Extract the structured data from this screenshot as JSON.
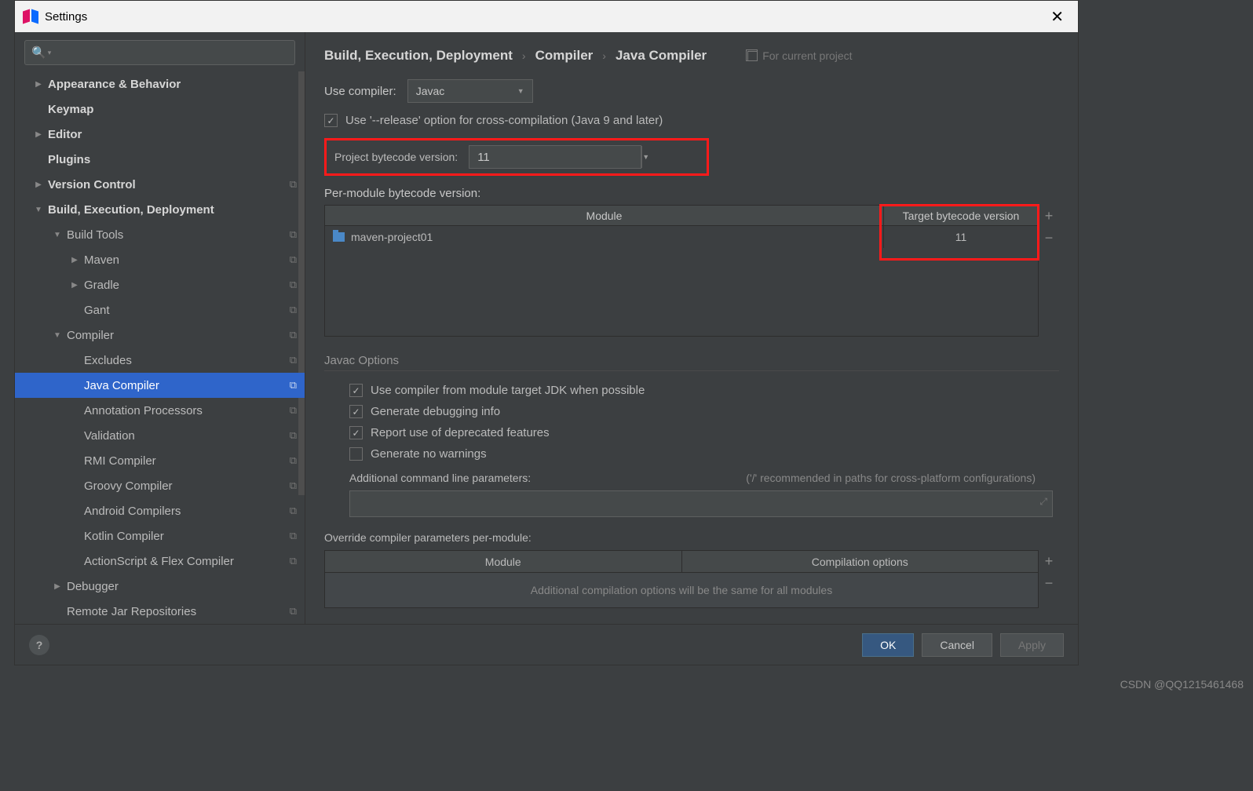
{
  "window": {
    "title": "Settings"
  },
  "sidebar": {
    "items": [
      {
        "label": "Appearance & Behavior",
        "indent": 0,
        "bold": true,
        "arrow": "▶",
        "copy": false
      },
      {
        "label": "Keymap",
        "indent": 0,
        "bold": true,
        "arrow": "",
        "copy": false
      },
      {
        "label": "Editor",
        "indent": 0,
        "bold": true,
        "arrow": "▶",
        "copy": false
      },
      {
        "label": "Plugins",
        "indent": 0,
        "bold": true,
        "arrow": "",
        "copy": false
      },
      {
        "label": "Version Control",
        "indent": 0,
        "bold": true,
        "arrow": "▶",
        "copy": true
      },
      {
        "label": "Build, Execution, Deployment",
        "indent": 0,
        "bold": true,
        "arrow": "▼",
        "copy": false
      },
      {
        "label": "Build Tools",
        "indent": 1,
        "bold": false,
        "arrow": "▼",
        "copy": true
      },
      {
        "label": "Maven",
        "indent": 2,
        "bold": false,
        "arrow": "▶",
        "copy": true
      },
      {
        "label": "Gradle",
        "indent": 2,
        "bold": false,
        "arrow": "▶",
        "copy": true
      },
      {
        "label": "Gant",
        "indent": 2,
        "bold": false,
        "arrow": "",
        "copy": true
      },
      {
        "label": "Compiler",
        "indent": 1,
        "bold": false,
        "arrow": "▼",
        "copy": true
      },
      {
        "label": "Excludes",
        "indent": 2,
        "bold": false,
        "arrow": "",
        "copy": true
      },
      {
        "label": "Java Compiler",
        "indent": 2,
        "bold": false,
        "arrow": "",
        "copy": true,
        "selected": true
      },
      {
        "label": "Annotation Processors",
        "indent": 2,
        "bold": false,
        "arrow": "",
        "copy": true
      },
      {
        "label": "Validation",
        "indent": 2,
        "bold": false,
        "arrow": "",
        "copy": true
      },
      {
        "label": "RMI Compiler",
        "indent": 2,
        "bold": false,
        "arrow": "",
        "copy": true
      },
      {
        "label": "Groovy Compiler",
        "indent": 2,
        "bold": false,
        "arrow": "",
        "copy": true
      },
      {
        "label": "Android Compilers",
        "indent": 2,
        "bold": false,
        "arrow": "",
        "copy": true
      },
      {
        "label": "Kotlin Compiler",
        "indent": 2,
        "bold": false,
        "arrow": "",
        "copy": true
      },
      {
        "label": "ActionScript & Flex Compiler",
        "indent": 2,
        "bold": false,
        "arrow": "",
        "copy": true
      },
      {
        "label": "Debugger",
        "indent": 1,
        "bold": false,
        "arrow": "▶",
        "copy": false
      },
      {
        "label": "Remote Jar Repositories",
        "indent": 1,
        "bold": false,
        "arrow": "",
        "copy": true
      }
    ]
  },
  "crumbs": {
    "a": "Build, Execution, Deployment",
    "b": "Compiler",
    "c": "Java Compiler",
    "proj": "For current project"
  },
  "main": {
    "use_compiler_label": "Use compiler:",
    "use_compiler_value": "Javac",
    "release_opt": "Use '--release' option for cross-compilation (Java 9 and later)",
    "proj_byte_label": "Project bytecode version:",
    "proj_byte_value": "11",
    "per_module_label": "Per-module bytecode version:",
    "mod_h1": "Module",
    "mod_h2": "Target bytecode version",
    "mod_row_name": "maven-project01",
    "mod_row_val": "11",
    "javac_title": "Javac Options",
    "opt1": "Use compiler from module target JDK when possible",
    "opt2": "Generate debugging info",
    "opt3": "Report use of deprecated features",
    "opt4": "Generate no warnings",
    "addl_label": "Additional command line parameters:",
    "addl_hint": "('/' recommended in paths for cross-platform configurations)",
    "override_label": "Override compiler parameters per-module:",
    "ov_h1": "Module",
    "ov_h2": "Compilation options",
    "ov_empty": "Additional compilation options will be the same for all modules"
  },
  "footer": {
    "ok": "OK",
    "cancel": "Cancel",
    "apply": "Apply"
  },
  "watermark": "CSDN @QQ1215461468"
}
